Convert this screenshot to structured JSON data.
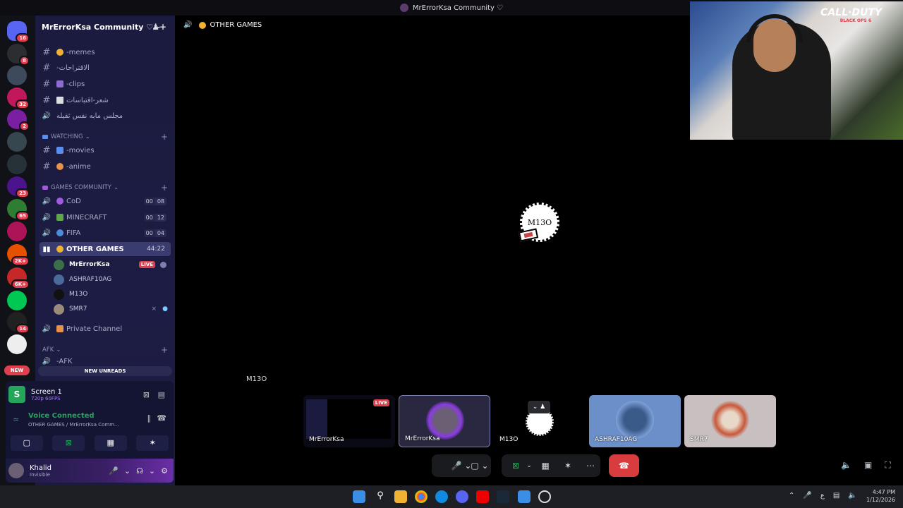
{
  "window": {
    "title": "MrErrorKsa Community ♡"
  },
  "servers": {
    "items": [
      {
        "name": "discord-home",
        "badge": "16",
        "color": "#5865f2"
      },
      {
        "name": "server-1",
        "badge": "8",
        "color": "#2b2d31"
      },
      {
        "name": "server-2",
        "badge": "",
        "color": "#3d4a5c"
      },
      {
        "name": "server-3",
        "badge": "32",
        "color": "#c2185b"
      },
      {
        "name": "server-4",
        "badge": "2",
        "color": "#7b1fa2"
      },
      {
        "name": "server-5",
        "badge": "",
        "color": "#37474f"
      },
      {
        "name": "server-6",
        "badge": "",
        "color": "#263238"
      },
      {
        "name": "server-7",
        "badge": "23",
        "color": "#4a148c"
      },
      {
        "name": "server-8",
        "badge": "65",
        "color": "#2e7d32"
      },
      {
        "name": "server-9",
        "badge": "",
        "color": "#ad1457"
      },
      {
        "name": "server-10",
        "badge": "2K+",
        "color": "#e65100"
      },
      {
        "name": "server-11",
        "badge": "6K+",
        "color": "#c62828"
      },
      {
        "name": "server-12",
        "badge": "",
        "color": "#00c853"
      },
      {
        "name": "server-13",
        "badge": "14",
        "color": "#212121"
      },
      {
        "name": "server-14",
        "badge": "",
        "color": "#eeeeee"
      }
    ],
    "new_label": "NEW"
  },
  "guild": {
    "name": "MrErrorKsa Community ♡"
  },
  "channels": {
    "memes": "-memes",
    "suggestions": "-الاقتراحات",
    "clips": "-clips",
    "poetry": "شعر-اقتباسات",
    "majlis": "مجلس مابه نفس ثقيله",
    "watching_cat": "WATCHING",
    "movies": "-movies",
    "anime": "-anime",
    "games_cat": "GAMES COMMUNITY",
    "cod": "CoD",
    "cod_count": [
      "00",
      "08"
    ],
    "minecraft": "MINECRAFT",
    "minecraft_count": [
      "00",
      "12"
    ],
    "fifa": "FIFA",
    "fifa_count": [
      "00",
      "04"
    ],
    "other_games": "OTHER GAMES",
    "other_games_timer": "44:22",
    "private": "Private Channel",
    "afk_cat": "AFK",
    "afk": "-AFK"
  },
  "voice_users": [
    {
      "name": "MrErrorKsa",
      "live": "LIVE"
    },
    {
      "name": "ASHRAF10AG"
    },
    {
      "name": "M13O"
    },
    {
      "name": "SMR7"
    }
  ],
  "new_unreads": "NEW UNREADS",
  "panel": {
    "screen_title": "Screen 1",
    "screen_sub": "720p 60FPS",
    "vc_title": "Voice Connected",
    "vc_sub": "OTHER GAMES / MrErrorKsa Comm...",
    "user_name": "Khalid",
    "user_status": "Invisible"
  },
  "stage": {
    "channel": "OTHER GAMES",
    "speaker_name": "M13O",
    "avatar_text": "M13O"
  },
  "tiles": [
    {
      "name": "MrErrorKsa",
      "live": "LIVE"
    },
    {
      "name": "MrErrorKsa"
    },
    {
      "name": "M13O"
    },
    {
      "name": "ASHRAF10AG"
    },
    {
      "name": "SMR7"
    }
  ],
  "camera": {
    "overlay_top": "CALL·DUTY",
    "overlay_sub": "BLACK OPS 6"
  },
  "taskbar": {
    "lang": "ع",
    "time": "4:47 PM",
    "date": "1/12/2026"
  },
  "icons": {
    "leave": "phone-hangup-icon",
    "mic": "microphone-icon",
    "camera": "camera-off-icon"
  }
}
